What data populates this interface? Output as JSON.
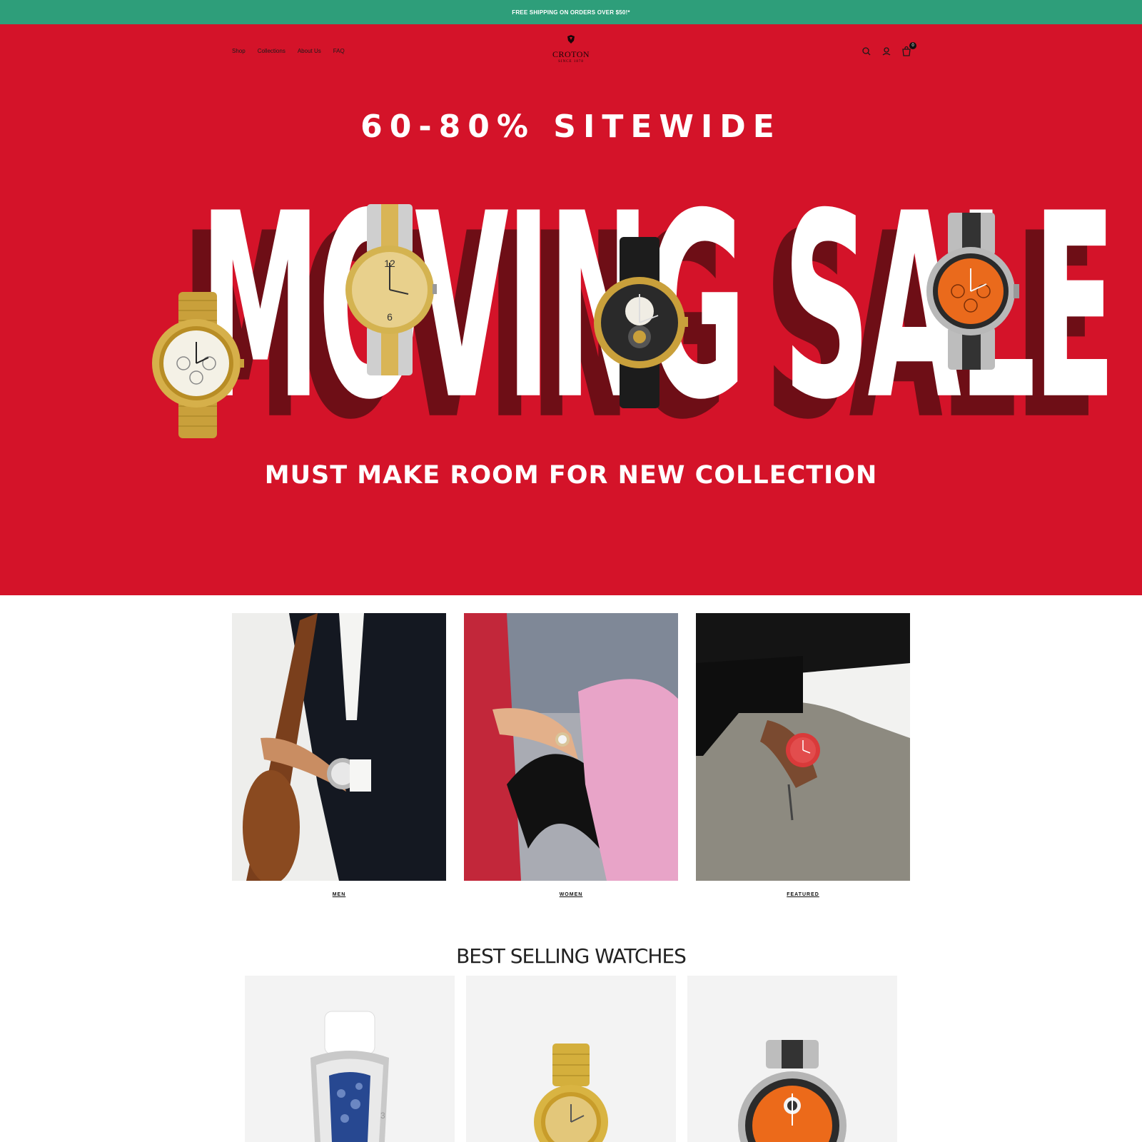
{
  "announcement": {
    "text": "FREE SHIPPING ON ORDERS OVER $50!*"
  },
  "nav": {
    "links": [
      "Shop",
      "Collections",
      "About Us",
      "FAQ"
    ]
  },
  "logo": {
    "name": "CROTON",
    "tagline": "SINCE 1878"
  },
  "header": {
    "cart_count": "0"
  },
  "hero": {
    "headline": "60-80% SITEWIDE",
    "title": "MOVING SALE",
    "subhead": "MUST MAKE ROOM FOR NEW COLLECTION"
  },
  "categories": [
    {
      "label": "MEN"
    },
    {
      "label": "WOMEN"
    },
    {
      "label": "FEATURED"
    }
  ],
  "best_selling": {
    "title": "BEST SELLING WATCHES"
  },
  "colors": {
    "announce": "#2e9e7a",
    "hero": "#d41329",
    "hero_shadow": "#6e0e16"
  }
}
